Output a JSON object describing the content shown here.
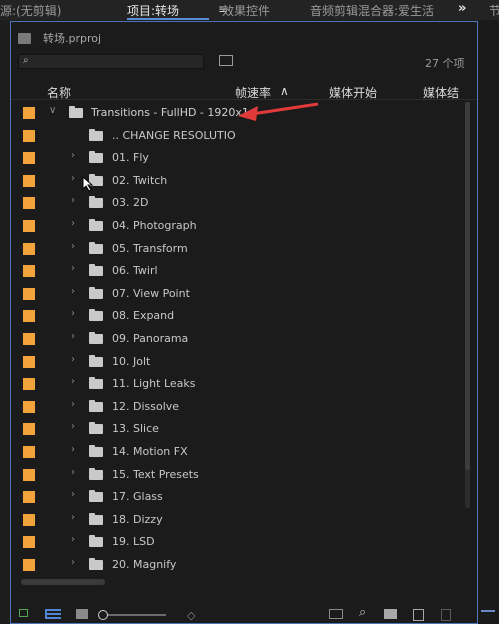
{
  "tabs": [
    {
      "label": "源:(无剪辑)"
    },
    {
      "label": "项目:转场"
    },
    {
      "label": "效果控件"
    },
    {
      "label": "音频剪辑混合器:爱生活"
    },
    {
      "label": "节"
    }
  ],
  "tab_menu_icon": "≡",
  "overflow_icon": "»",
  "project": {
    "bin_file": "转场.prproj",
    "search_placeholder": "",
    "item_count": "27 个项"
  },
  "columns": {
    "name": "名称",
    "frame_rate": "帧速率",
    "media_start": "媒体开始",
    "media_end": "媒体结"
  },
  "rows": [
    {
      "label": "Transitions - FullHD - 1920x1",
      "expanded": true
    },
    {
      "label": ".. CHANGE RESOLUTIO"
    },
    {
      "label": "01. Fly"
    },
    {
      "label": "02. Twitch"
    },
    {
      "label": "03. 2D"
    },
    {
      "label": "04. Photograph"
    },
    {
      "label": "05. Transform"
    },
    {
      "label": "06. Twirl"
    },
    {
      "label": "07. View Point"
    },
    {
      "label": "08. Expand"
    },
    {
      "label": "09. Panorama"
    },
    {
      "label": "10. Jolt"
    },
    {
      "label": "11. Light Leaks"
    },
    {
      "label": "12. Dissolve"
    },
    {
      "label": "13. Slice"
    },
    {
      "label": "14. Motion FX"
    },
    {
      "label": "15. Text Presets"
    },
    {
      "label": "17. Glass"
    },
    {
      "label": "18. Dizzy"
    },
    {
      "label": "19. LSD"
    },
    {
      "label": "20. Magnify"
    }
  ],
  "colors": {
    "label_swatch": "#f2a33b",
    "panel_border": "#5074b8",
    "annotation": "#e03a3a"
  },
  "icons": [
    "bin-icon",
    "search-icon",
    "new-bin-search-icon",
    "folder-icon",
    "chevron-icon",
    "lock-icon",
    "list-view-icon",
    "icon-view-icon",
    "zoom-slider",
    "sort-icon",
    "automate-icon",
    "find-icon",
    "new-bin-icon",
    "new-item-icon",
    "clear-icon"
  ]
}
